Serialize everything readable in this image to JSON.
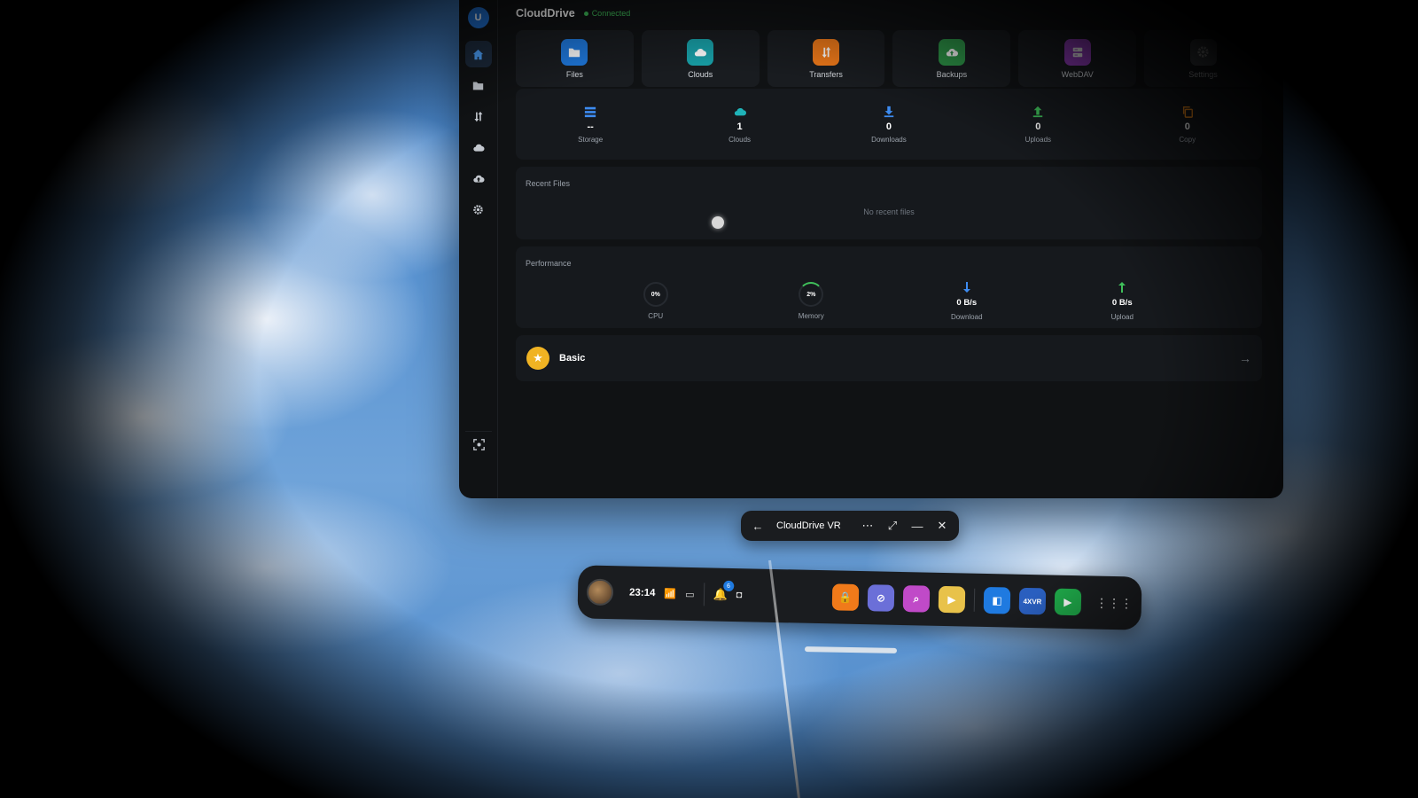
{
  "app": {
    "title": "CloudDrive",
    "status": "Connected",
    "avatar_initial": "U"
  },
  "sidebar": {
    "items": [
      {
        "name": "home-icon",
        "active": true
      },
      {
        "name": "folder-icon",
        "active": false
      },
      {
        "name": "transfer-icon",
        "active": false
      },
      {
        "name": "cloud-icon",
        "active": false
      },
      {
        "name": "cloud-upload-icon",
        "active": false
      },
      {
        "name": "gear-icon",
        "active": false
      }
    ],
    "bottom_icon": "scan-icon"
  },
  "quick_actions": [
    {
      "label": "Files",
      "icon": "folder-icon",
      "color": "#1f7ae0"
    },
    {
      "label": "Clouds",
      "icon": "cloud-icon",
      "color": "#18a0a8"
    },
    {
      "label": "Transfers",
      "icon": "transfer-icon",
      "color": "#f07a1a"
    },
    {
      "label": "Backups",
      "icon": "cloud-upload-icon",
      "color": "#2f9a4a"
    },
    {
      "label": "WebDAV",
      "icon": "server-icon",
      "color": "#9b3fc8"
    },
    {
      "label": "Settings",
      "icon": "gear-icon",
      "color": "#5a6068"
    }
  ],
  "stats": [
    {
      "label": "Storage",
      "value": "--",
      "icon": "storage-icon",
      "color": "#3d8bf0"
    },
    {
      "label": "Clouds",
      "value": "1",
      "icon": "cloud-icon",
      "color": "#1fb3b8"
    },
    {
      "label": "Downloads",
      "value": "0",
      "icon": "download-icon",
      "color": "#3d8bf0"
    },
    {
      "label": "Uploads",
      "value": "0",
      "icon": "upload-icon",
      "color": "#3fbf5a"
    },
    {
      "label": "Copy",
      "value": "0",
      "icon": "copy-icon",
      "color": "#f08a1a"
    }
  ],
  "recent_files": {
    "title": "Recent Files",
    "empty_text": "No recent files"
  },
  "performance": {
    "title": "Performance",
    "cpu": {
      "label": "CPU",
      "value": "0%"
    },
    "memory": {
      "label": "Memory",
      "value": "2%"
    },
    "download": {
      "label": "Download",
      "value": "0 B/s",
      "color": "#3d8bf0"
    },
    "upload": {
      "label": "Upload",
      "value": "0 B/s",
      "color": "#3fbf5a"
    }
  },
  "plan": {
    "name": "Basic"
  },
  "window_bar": {
    "title": "CloudDrive VR"
  },
  "dock": {
    "time": "23:14",
    "notification_count": "6",
    "apps": [
      {
        "name": "store-lock-app-icon",
        "color": "#f07a1a",
        "glyph": "🔒"
      },
      {
        "name": "browser-app-icon",
        "color": "#6b6fd8",
        "glyph": "⊘"
      },
      {
        "name": "search-app-icon",
        "color": "#c04ac8",
        "glyph": "⌕"
      },
      {
        "name": "media-app-icon",
        "color": "#e8c24a",
        "glyph": "▶"
      },
      {
        "name": "clouddrive-app-icon",
        "color": "#1f7ae0",
        "glyph": "◧"
      },
      {
        "name": "4xvr-app-icon",
        "color": "#2a5fbf",
        "glyph": "4XVR"
      },
      {
        "name": "play-app-icon",
        "color": "#1faa4a",
        "glyph": "▶"
      }
    ]
  }
}
